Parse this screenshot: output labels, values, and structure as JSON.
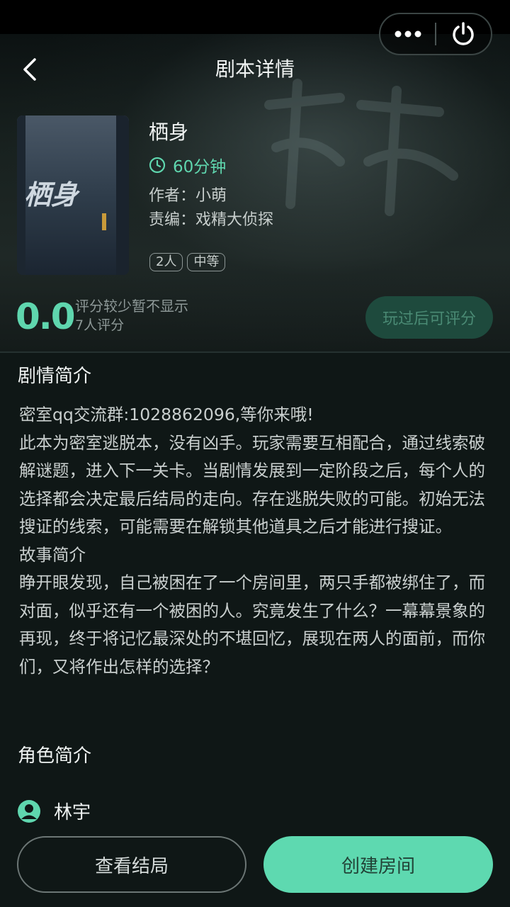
{
  "nav": {
    "title": "剧本详情",
    "more_icon": "more-dots-icon",
    "power_icon": "power-icon",
    "back_icon": "chevron-left-icon"
  },
  "script": {
    "title": "栖身",
    "duration": "60分钟",
    "author": "作者：小萌",
    "editor": "责编：戏精大侦探",
    "tags": [
      "2人",
      "中等"
    ],
    "cover_title": "栖身"
  },
  "rating": {
    "score": "0.0",
    "note": "评分较少暂不显示",
    "count": "7人评分",
    "rate_button": "玩过后可评分"
  },
  "plot": {
    "section_title": "剧情简介",
    "paragraphs": [
      "密室qq交流群:1028862096,等你来哦!",
      "此本为密室逃脱本，没有凶手。玩家需要互相配合，通过线索破解谜题，进入下一关卡。当剧情发展到一定阶段之后，每个人的选择都会决定最后结局的走向。存在逃脱失败的可能。初始无法搜证的线索，可能需要在解锁其他道具之后才能进行搜证。",
      "故事简介",
      "睁开眼发现，自己被困在了一个房间里，两只手都被绑住了，而对面，似乎还有一个被困的人。究竟发生了什么？一幕幕景象的再现，终于将记忆最深处的不堪回忆，展现在两人的面前，而你们，又将作出怎样的选择？"
    ]
  },
  "roles": {
    "section_title": "角色简介",
    "items": [
      {
        "name": "林宇",
        "icon": "user-avatar-icon"
      }
    ]
  },
  "actions": {
    "view_ending": "查看结局",
    "create_room": "创建房间"
  },
  "colors": {
    "accent": "#5ed9b0",
    "background": "#0f1716"
  }
}
